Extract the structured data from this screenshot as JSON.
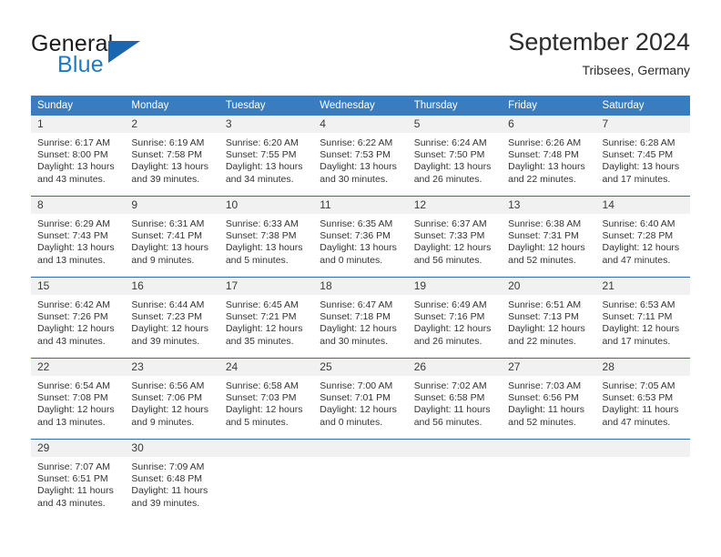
{
  "logo": {
    "word_top": "General",
    "word_bottom": "Blue",
    "accent_color": "#1f7ac4",
    "triangle_color": "#1a66b0",
    "triangle_icon": "triangle-icon"
  },
  "header": {
    "title": "September 2024",
    "subtitle": "Tribsees, Germany"
  },
  "theme": {
    "header_row_bg": "#3a7cc0",
    "daynum_bg": "#f1f1f1",
    "row_divider": "#2f6ca8",
    "text": "#333333"
  },
  "weekday_headers": [
    "Sunday",
    "Monday",
    "Tuesday",
    "Wednesday",
    "Thursday",
    "Friday",
    "Saturday"
  ],
  "labels": {
    "sunrise_prefix": "Sunrise:",
    "sunset_prefix": "Sunset:",
    "daylight_prefix": "Daylight:"
  },
  "weeks": [
    {
      "days": [
        {
          "num": "1",
          "sunrise": "Sunrise: 6:17 AM",
          "sunset": "Sunset: 8:00 PM",
          "daylight": "Daylight: 13 hours and 43 minutes."
        },
        {
          "num": "2",
          "sunrise": "Sunrise: 6:19 AM",
          "sunset": "Sunset: 7:58 PM",
          "daylight": "Daylight: 13 hours and 39 minutes."
        },
        {
          "num": "3",
          "sunrise": "Sunrise: 6:20 AM",
          "sunset": "Sunset: 7:55 PM",
          "daylight": "Daylight: 13 hours and 34 minutes."
        },
        {
          "num": "4",
          "sunrise": "Sunrise: 6:22 AM",
          "sunset": "Sunset: 7:53 PM",
          "daylight": "Daylight: 13 hours and 30 minutes."
        },
        {
          "num": "5",
          "sunrise": "Sunrise: 6:24 AM",
          "sunset": "Sunset: 7:50 PM",
          "daylight": "Daylight: 13 hours and 26 minutes."
        },
        {
          "num": "6",
          "sunrise": "Sunrise: 6:26 AM",
          "sunset": "Sunset: 7:48 PM",
          "daylight": "Daylight: 13 hours and 22 minutes."
        },
        {
          "num": "7",
          "sunrise": "Sunrise: 6:28 AM",
          "sunset": "Sunset: 7:45 PM",
          "daylight": "Daylight: 13 hours and 17 minutes."
        }
      ]
    },
    {
      "days": [
        {
          "num": "8",
          "sunrise": "Sunrise: 6:29 AM",
          "sunset": "Sunset: 7:43 PM",
          "daylight": "Daylight: 13 hours and 13 minutes."
        },
        {
          "num": "9",
          "sunrise": "Sunrise: 6:31 AM",
          "sunset": "Sunset: 7:41 PM",
          "daylight": "Daylight: 13 hours and 9 minutes."
        },
        {
          "num": "10",
          "sunrise": "Sunrise: 6:33 AM",
          "sunset": "Sunset: 7:38 PM",
          "daylight": "Daylight: 13 hours and 5 minutes."
        },
        {
          "num": "11",
          "sunrise": "Sunrise: 6:35 AM",
          "sunset": "Sunset: 7:36 PM",
          "daylight": "Daylight: 13 hours and 0 minutes."
        },
        {
          "num": "12",
          "sunrise": "Sunrise: 6:37 AM",
          "sunset": "Sunset: 7:33 PM",
          "daylight": "Daylight: 12 hours and 56 minutes."
        },
        {
          "num": "13",
          "sunrise": "Sunrise: 6:38 AM",
          "sunset": "Sunset: 7:31 PM",
          "daylight": "Daylight: 12 hours and 52 minutes."
        },
        {
          "num": "14",
          "sunrise": "Sunrise: 6:40 AM",
          "sunset": "Sunset: 7:28 PM",
          "daylight": "Daylight: 12 hours and 47 minutes."
        }
      ]
    },
    {
      "days": [
        {
          "num": "15",
          "sunrise": "Sunrise: 6:42 AM",
          "sunset": "Sunset: 7:26 PM",
          "daylight": "Daylight: 12 hours and 43 minutes."
        },
        {
          "num": "16",
          "sunrise": "Sunrise: 6:44 AM",
          "sunset": "Sunset: 7:23 PM",
          "daylight": "Daylight: 12 hours and 39 minutes."
        },
        {
          "num": "17",
          "sunrise": "Sunrise: 6:45 AM",
          "sunset": "Sunset: 7:21 PM",
          "daylight": "Daylight: 12 hours and 35 minutes."
        },
        {
          "num": "18",
          "sunrise": "Sunrise: 6:47 AM",
          "sunset": "Sunset: 7:18 PM",
          "daylight": "Daylight: 12 hours and 30 minutes."
        },
        {
          "num": "19",
          "sunrise": "Sunrise: 6:49 AM",
          "sunset": "Sunset: 7:16 PM",
          "daylight": "Daylight: 12 hours and 26 minutes."
        },
        {
          "num": "20",
          "sunrise": "Sunrise: 6:51 AM",
          "sunset": "Sunset: 7:13 PM",
          "daylight": "Daylight: 12 hours and 22 minutes."
        },
        {
          "num": "21",
          "sunrise": "Sunrise: 6:53 AM",
          "sunset": "Sunset: 7:11 PM",
          "daylight": "Daylight: 12 hours and 17 minutes."
        }
      ]
    },
    {
      "days": [
        {
          "num": "22",
          "sunrise": "Sunrise: 6:54 AM",
          "sunset": "Sunset: 7:08 PM",
          "daylight": "Daylight: 12 hours and 13 minutes."
        },
        {
          "num": "23",
          "sunrise": "Sunrise: 6:56 AM",
          "sunset": "Sunset: 7:06 PM",
          "daylight": "Daylight: 12 hours and 9 minutes."
        },
        {
          "num": "24",
          "sunrise": "Sunrise: 6:58 AM",
          "sunset": "Sunset: 7:03 PM",
          "daylight": "Daylight: 12 hours and 5 minutes."
        },
        {
          "num": "25",
          "sunrise": "Sunrise: 7:00 AM",
          "sunset": "Sunset: 7:01 PM",
          "daylight": "Daylight: 12 hours and 0 minutes."
        },
        {
          "num": "26",
          "sunrise": "Sunrise: 7:02 AM",
          "sunset": "Sunset: 6:58 PM",
          "daylight": "Daylight: 11 hours and 56 minutes."
        },
        {
          "num": "27",
          "sunrise": "Sunrise: 7:03 AM",
          "sunset": "Sunset: 6:56 PM",
          "daylight": "Daylight: 11 hours and 52 minutes."
        },
        {
          "num": "28",
          "sunrise": "Sunrise: 7:05 AM",
          "sunset": "Sunset: 6:53 PM",
          "daylight": "Daylight: 11 hours and 47 minutes."
        }
      ]
    },
    {
      "days": [
        {
          "num": "29",
          "sunrise": "Sunrise: 7:07 AM",
          "sunset": "Sunset: 6:51 PM",
          "daylight": "Daylight: 11 hours and 43 minutes."
        },
        {
          "num": "30",
          "sunrise": "Sunrise: 7:09 AM",
          "sunset": "Sunset: 6:48 PM",
          "daylight": "Daylight: 11 hours and 39 minutes."
        },
        {
          "num": "",
          "sunrise": "",
          "sunset": "",
          "daylight": ""
        },
        {
          "num": "",
          "sunrise": "",
          "sunset": "",
          "daylight": ""
        },
        {
          "num": "",
          "sunrise": "",
          "sunset": "",
          "daylight": ""
        },
        {
          "num": "",
          "sunrise": "",
          "sunset": "",
          "daylight": ""
        },
        {
          "num": "",
          "sunrise": "",
          "sunset": "",
          "daylight": ""
        }
      ]
    }
  ]
}
